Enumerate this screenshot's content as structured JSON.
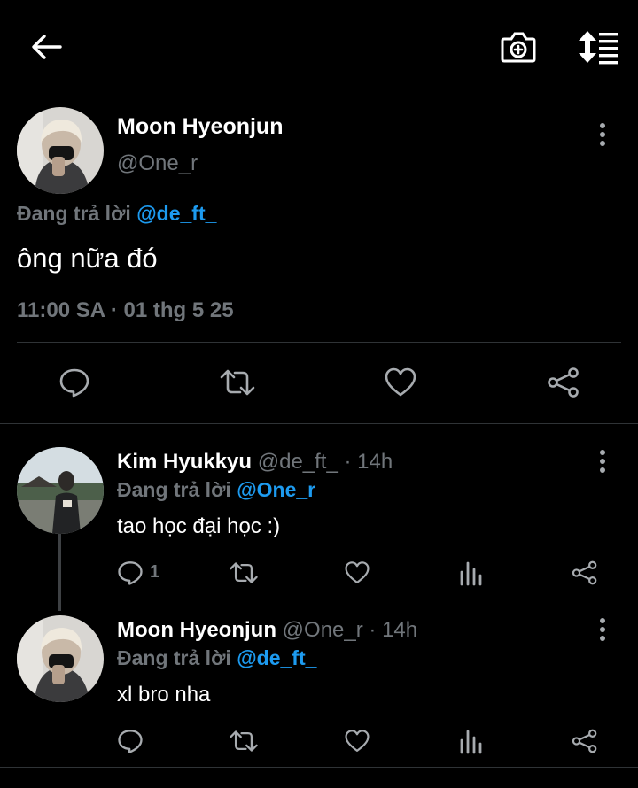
{
  "colors": {
    "background": "#000000",
    "text": "#e7e9ea",
    "muted": "#71767b",
    "link": "#1d9bf0",
    "divider": "#2f3336"
  },
  "topbar": {
    "back_icon": "arrow-left-icon",
    "camera_icon": "camera-add-icon",
    "sort_icon": "sort-list-icon"
  },
  "main_tweet": {
    "name": "Moon Hyeonjun",
    "handle": "@One_r",
    "reply_prefix": "Đang trả lời",
    "reply_to": "@de_ft_",
    "text": "ông nữa đó",
    "timestamp": "11:00 SA · 01 thg 5 25"
  },
  "replies": [
    {
      "name": "Kim Hyukkyu",
      "handle": "@de_ft_",
      "time": "· 14h",
      "reply_prefix": "Đang trả lời",
      "reply_to": "@One_r",
      "text": "tao học đại học :)",
      "reply_count": "1"
    },
    {
      "name": "Moon Hyeonjun",
      "handle": "@One_r",
      "time": "· 14h",
      "reply_prefix": "Đang trả lời",
      "reply_to": "@de_ft_",
      "text": "xl bro nha",
      "reply_count": ""
    }
  ]
}
